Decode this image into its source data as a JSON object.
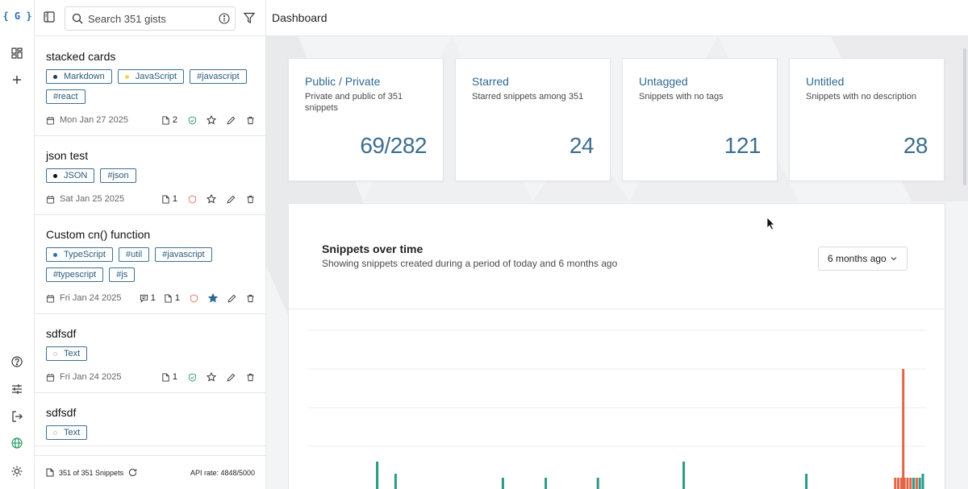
{
  "rail": {
    "logo": "{ G }",
    "icons": [
      "dashboard-icon",
      "plus-icon",
      "help-icon",
      "sliders-icon",
      "logout-icon",
      "globe-icon",
      "sun-icon"
    ]
  },
  "sidebar": {
    "search_placeholder": "Search 351 gists",
    "items": [
      {
        "title": "stacked cards",
        "tags": [
          {
            "label": "Markdown",
            "dot": "#1f3b57"
          },
          {
            "label": "JavaScript",
            "dot": "#f1d45a"
          },
          {
            "label": "#javascript"
          },
          {
            "label": "#react"
          }
        ],
        "date": "Mon Jan 27 2025",
        "files": "2",
        "visibility": "public",
        "starred": false
      },
      {
        "title": "json test",
        "tags": [
          {
            "label": "JSON",
            "dot": "#111111"
          },
          {
            "label": "#json"
          }
        ],
        "date": "Sat Jan 25 2025",
        "files": "1",
        "visibility": "private",
        "starred": false
      },
      {
        "title": "Custom cn() function",
        "tags": [
          {
            "label": "TypeScript",
            "dot": "#2f6fb0"
          },
          {
            "label": "#util"
          },
          {
            "label": "#javascript"
          },
          {
            "label": "#typescript"
          },
          {
            "label": "#js"
          }
        ],
        "date": "Fri Jan 24 2025",
        "comments": "1",
        "files": "1",
        "visibility": "private",
        "starred": true
      },
      {
        "title": "sdfsdf",
        "tags": [
          {
            "label": "Text",
            "dot": "#ffffff"
          }
        ],
        "date": "Fri Jan 24 2025",
        "files": "1",
        "visibility": "public",
        "starred": false
      },
      {
        "title": "sdfsdf",
        "tags": [
          {
            "label": "Text",
            "dot": "#ffffff"
          }
        ]
      }
    ],
    "footer": {
      "count": "351 of 351 Snippets",
      "api_rate": "API rate: 4848/5000"
    }
  },
  "main": {
    "title": "Dashboard",
    "stats": [
      {
        "title": "Public / Private",
        "desc": "Private and public of 351 snippets",
        "value": "69/282"
      },
      {
        "title": "Starred",
        "desc": "Starred snippets among 351",
        "value": "24"
      },
      {
        "title": "Untagged",
        "desc": "Snippets with no tags",
        "value": "121"
      },
      {
        "title": "Untitled",
        "desc": "Snippets with no description",
        "value": "28"
      }
    ],
    "chart": {
      "title": "Snippets over time",
      "subtitle": "Showing snippets created during a period of today and 6 months ago",
      "range_label": "6 months ago"
    }
  },
  "colors": {
    "accent": "#2e6a93",
    "bar_teal": "#2a9a86",
    "bar_orange": "#e0664a"
  },
  "chart_data": {
    "type": "bar",
    "title": "Snippets over time",
    "series": [
      {
        "values": [
          [
            0.11,
            7
          ],
          [
            0.14,
            4
          ],
          [
            0.61,
            7
          ],
          [
            0.81,
            4
          ],
          [
            0.985,
            3
          ],
          [
            0.995,
            3
          ],
          [
            1.0,
            4
          ]
        ]
      },
      {
        "values": [
          [
            0.955,
            3
          ],
          [
            0.96,
            3
          ],
          [
            0.965,
            3
          ],
          [
            0.97,
            3
          ],
          [
            0.975,
            3
          ],
          [
            0.98,
            3
          ],
          [
            0.99,
            3
          ]
        ]
      },
      {
        "values": [
          [
            0.315,
            3
          ],
          [
            0.385,
            3
          ],
          [
            0.47,
            3
          ],
          [
            0.968,
            30
          ]
        ]
      }
    ],
    "grid": true,
    "ylim": [
      0,
      40
    ]
  }
}
